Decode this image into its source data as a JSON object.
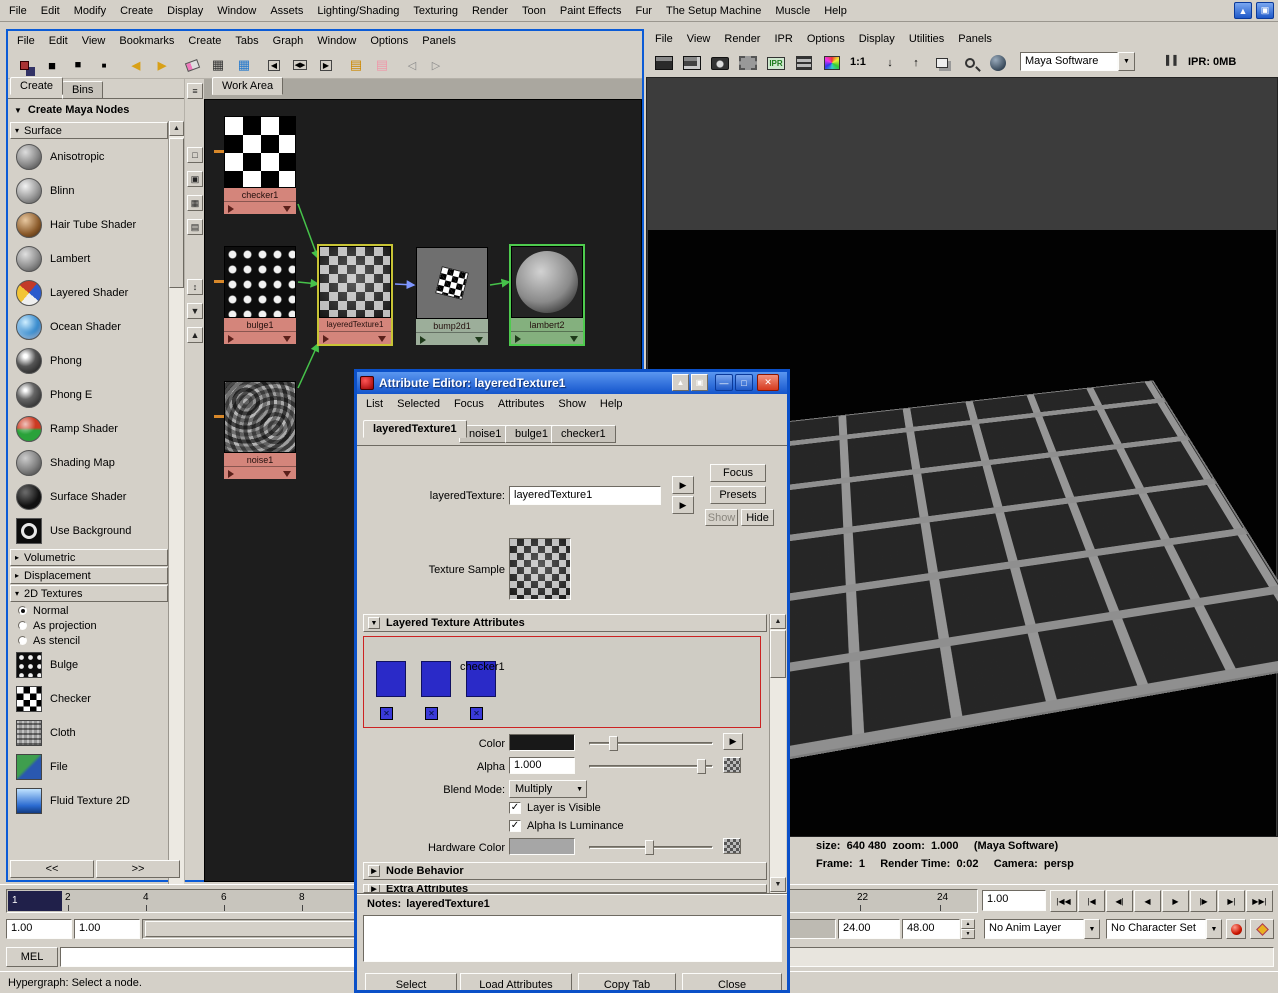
{
  "icons": {
    "tri_down": "▼",
    "tri_right": "▶",
    "tri_down_sm": "▾",
    "tri_right_sm": "▸",
    "arrow_up": "▲",
    "arrow_left": "◀",
    "arrow_right": "▶",
    "arrow_down": "▼",
    "check": "✓",
    "cross": "✕",
    "minimize": "—",
    "maximize": "□",
    "restore": "▣",
    "pause": "▌▌",
    "menu": "≡",
    "updown": "↕",
    "box_empty": "□",
    "box_checked": "▣",
    "grid": "▦",
    "rows": "▤",
    "sq_large": "■",
    "sq_med": "▪",
    "sq_small": "▫",
    "keep_image": "↓",
    "remove_image": "↑",
    "prev": "◁",
    "next": "▷",
    "layer_x": "✕"
  },
  "main_menu": {
    "items": [
      "File",
      "Edit",
      "Modify",
      "Create",
      "Display",
      "Window",
      "Assets",
      "Lighting/Shading",
      "Texturing",
      "Render",
      "Toon",
      "Paint Effects",
      "Fur",
      "The Setup Machine",
      "Muscle",
      "Help"
    ]
  },
  "hypershade": {
    "menu": [
      "File",
      "Edit",
      "View",
      "Bookmarks",
      "Create",
      "Tabs",
      "Graph",
      "Window",
      "Options",
      "Panels"
    ],
    "tabs": [
      "Create",
      "Bins"
    ],
    "create_nodes_label": "Create Maya Nodes",
    "sections": {
      "surface": "Surface",
      "volumetric": "Volumetric",
      "displacement": "Displacement",
      "textures2d": "2D Textures"
    },
    "surface_items": [
      "Anisotropic",
      "Blinn",
      "Hair Tube Shader",
      "Lambert",
      "Layered Shader",
      "Ocean Shader",
      "Phong",
      "Phong E",
      "Ramp Shader",
      "Shading Map",
      "Surface Shader",
      "Use Background"
    ],
    "radio_items": [
      "Normal",
      "As projection",
      "As stencil"
    ],
    "texture_items": [
      "Bulge",
      "Checker",
      "Cloth",
      "File",
      "Fluid Texture 2D"
    ],
    "work_area_tab": "Work Area",
    "nav_prev": "<<",
    "nav_next": ">>",
    "nodes": {
      "checker": "checker1",
      "bulge": "bulge1",
      "layered": "layeredTexture1",
      "bump": "bump2d1",
      "lambert": "lambert2",
      "noise": "noise1"
    }
  },
  "render_view": {
    "menu": [
      "File",
      "View",
      "Render",
      "IPR",
      "Options",
      "Display",
      "Utilities",
      "Panels"
    ],
    "ratio": "1:1",
    "renderer": "Maya Software",
    "ipr_status": "IPR: 0MB",
    "status": {
      "size_label": "size:",
      "size_value": "640  480",
      "zoom_label": "zoom:",
      "zoom_value": "1.000",
      "renderer_note": "(Maya Software)",
      "frame_label": "Frame:",
      "frame_value": "1",
      "time_label": "Render Time:",
      "time_value": "0:02",
      "camera_label": "Camera:",
      "camera_value": "persp"
    }
  },
  "attribute_editor": {
    "title": "Attribute Editor: layeredTexture1",
    "menu": [
      "List",
      "Selected",
      "Focus",
      "Attributes",
      "Show",
      "Help"
    ],
    "tabs": [
      "layeredTexture1",
      "noise1",
      "bulge1",
      "checker1"
    ],
    "name_label": "layeredTexture:",
    "name_value": "layeredTexture1",
    "focus_button": "Focus",
    "presets_button": "Presets",
    "show_button": "Show",
    "hide_button": "Hide",
    "texture_sample_label": "Texture Sample",
    "section_layered": "Layered Texture Attributes",
    "layer_label": "checker1",
    "color_label": "Color",
    "alpha_label": "Alpha",
    "alpha_value": "1.000",
    "blend_label": "Blend Mode:",
    "blend_value": "Multiply",
    "visible_checkbox": "Layer is Visible",
    "alpha_lum_checkbox": "Alpha Is Luminance",
    "hardware_label": "Hardware Color",
    "section_node_behavior": "Node Behavior",
    "section_extra": "Extra Attributes",
    "notes_label": "Notes:",
    "notes_value": "layeredTexture1",
    "footer_buttons": [
      "Select",
      "Load Attributes",
      "Copy Tab",
      "Close"
    ]
  },
  "timeline": {
    "current_frame": "1",
    "ticks": [
      "2",
      "4",
      "6",
      "8",
      "22",
      "24"
    ],
    "current_time_field": "1.00",
    "range_start": "1.00",
    "playback_start": "1.00",
    "playback_end": "24.00",
    "range_end": "48.00",
    "anim_layer": "No Anim Layer",
    "character_set": "No Character Set",
    "playback": [
      "|◀◀",
      "|◀",
      "◀|",
      "◀",
      "▶",
      "|▶",
      "▶|",
      "▶▶|"
    ]
  },
  "command_line": {
    "label": "MEL"
  },
  "help_line": "Hypergraph: Select a node."
}
